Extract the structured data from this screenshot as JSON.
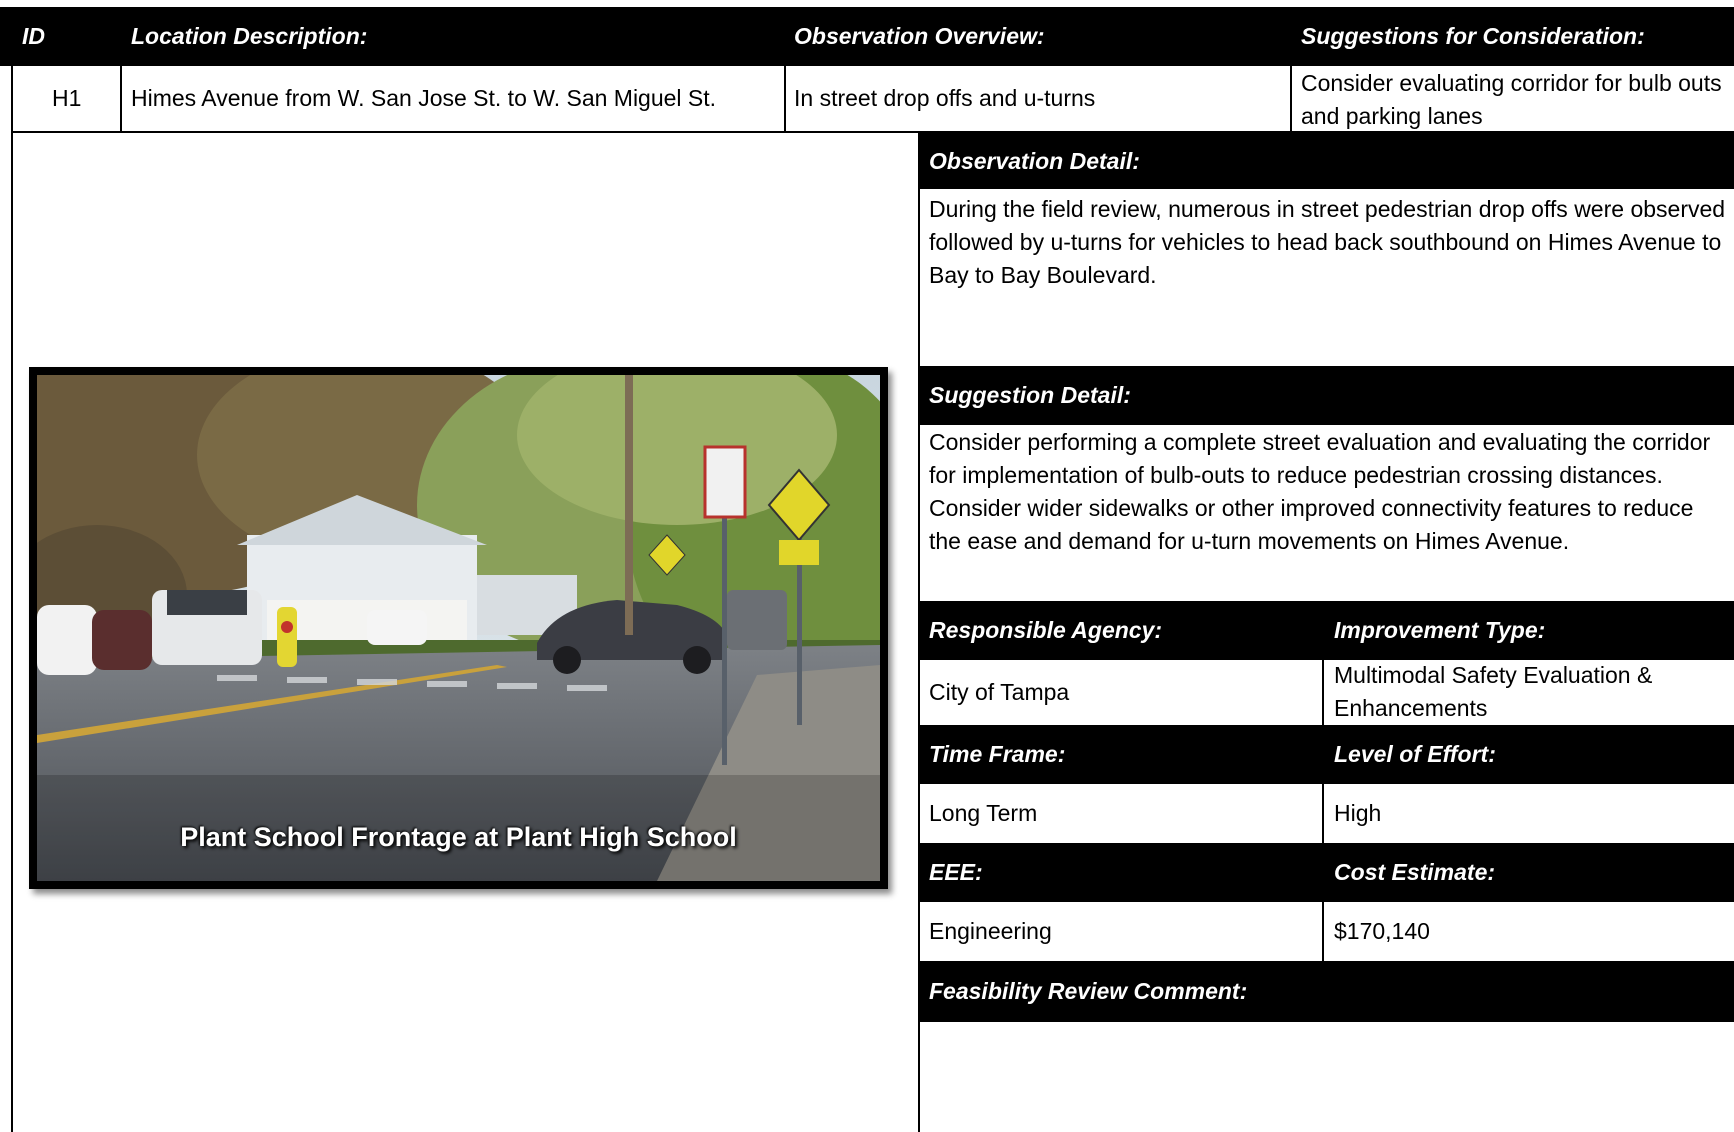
{
  "header": {
    "id_label": "ID",
    "location_label": "Location Description:",
    "observation_overview_label": "Observation Overview:",
    "suggestions_label": "Suggestions for Consideration:"
  },
  "row": {
    "id": "H1",
    "location": "Himes Avenue from W. San Jose St. to W. San Miguel St.",
    "observation": "In street drop offs and u-turns",
    "suggestion": "Consider evaluating corridor for bulb outs and parking lanes"
  },
  "observation_detail": {
    "label": "Observation Detail:",
    "text": "During the field review, numerous in street pedestrian drop offs were observed followed by u-turns for vehicles to head back southbound on Himes Avenue to Bay to Bay Boulevard."
  },
  "suggestion_detail": {
    "label": "Suggestion Detail:",
    "text": "Consider performing a complete street evaluation and evaluating the corridor for implementation of bulb-outs to reduce pedestrian crossing distances. Consider wider sidewalks or other improved connectivity features to reduce the ease and demand for u-turn movements on Himes Avenue."
  },
  "details": {
    "responsible_agency_label": "Responsible Agency:",
    "responsible_agency": "City of Tampa",
    "improvement_type_label": "Improvement Type:",
    "improvement_type": "Multimodal Safety Evaluation & Enhancements",
    "time_frame_label": "Time Frame:",
    "time_frame": "Long Term",
    "level_of_effort_label": "Level of Effort:",
    "level_of_effort": "High",
    "eee_label": "EEE:",
    "eee": "Engineering",
    "cost_estimate_label": "Cost Estimate:",
    "cost_estimate": "$170,140",
    "feasibility_label": "Feasibility Review Comment:",
    "feasibility": ""
  },
  "photo": {
    "caption": "Plant School Frontage at Plant High School"
  }
}
